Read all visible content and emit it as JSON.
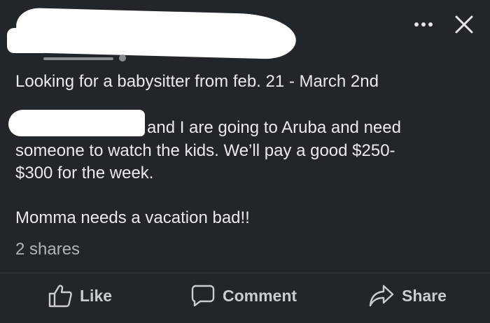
{
  "post": {
    "lines": [
      "Looking for a babysitter from feb. 21 - March 2nd",
      "and I are going to Aruba and need",
      "someone to watch the kids. We’ll pay a good $250-",
      "$300 for the week.",
      "Momma needs a vacation bad!!"
    ]
  },
  "stats": {
    "shares": "2 shares"
  },
  "actions": {
    "like": "Like",
    "comment": "Comment",
    "share": "Share"
  },
  "icons": {
    "more": "more-options-icon",
    "close": "close-icon",
    "like": "thumbs-up-icon",
    "comment": "comment-bubble-icon",
    "share": "share-arrow-icon"
  },
  "colors": {
    "background": "#222529",
    "text": "#e8eaed",
    "muted": "#b0b3b8",
    "redaction": "#ffffff"
  }
}
